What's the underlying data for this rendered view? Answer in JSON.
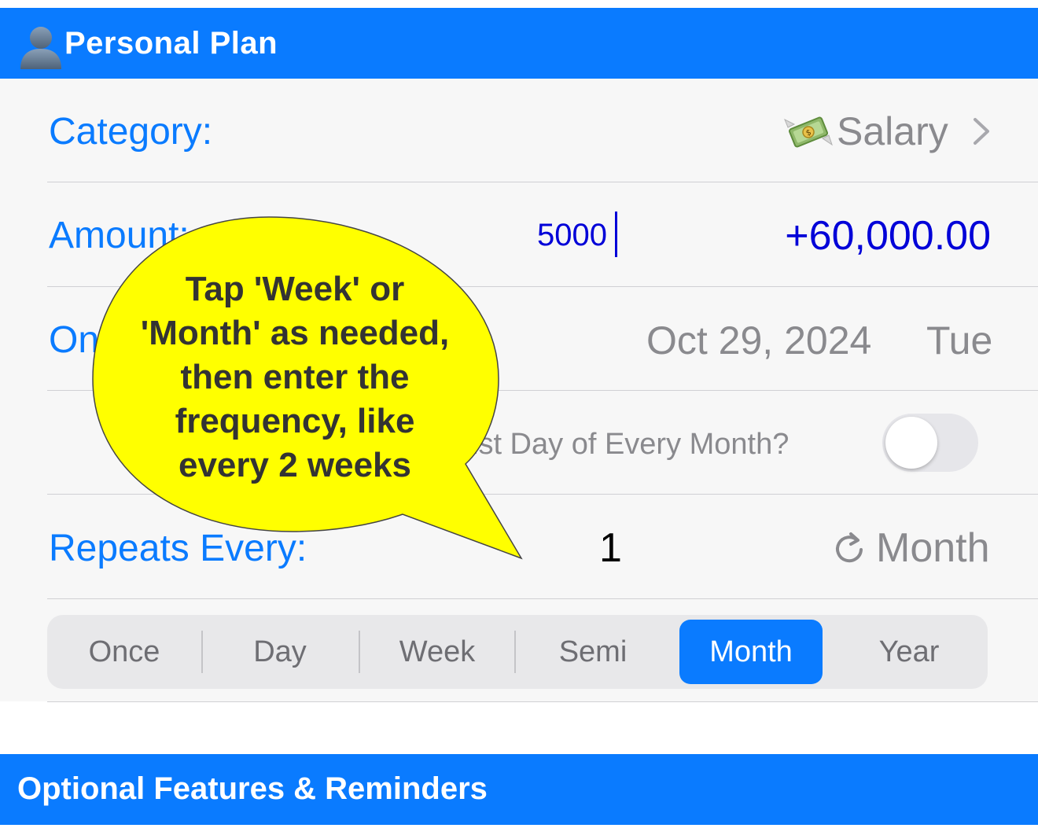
{
  "header": {
    "title": "Personal Plan",
    "icon": "person-icon",
    "color": "#0a7bff"
  },
  "form": {
    "category": {
      "label": "Category:",
      "value": "Salary",
      "icon": "money-with-wings-icon"
    },
    "amount": {
      "label": "Amount:",
      "input_value": "5000",
      "total": "+60,000.00",
      "total_color": "#0000d8"
    },
    "on": {
      "label": "On",
      "date": "Oct 29, 2024",
      "weekday": "Tue"
    },
    "last_day": {
      "label_visible": "ist Day of Every Month?",
      "toggle_on": false
    },
    "repeats": {
      "label": "Repeats Every:",
      "count": "1",
      "unit": "Month",
      "icon": "repeat-icon"
    },
    "frequency": {
      "options": [
        "Once",
        "Day",
        "Week",
        "Semi",
        "Month",
        "Year"
      ],
      "selected": "Month"
    }
  },
  "callout": {
    "lines": [
      "Tap 'Week' or",
      "'Month' as needed,",
      "then enter the",
      "frequency, like",
      "every 2 weeks"
    ],
    "fill_color": "#ffff00"
  },
  "footer": {
    "title": "Optional Features & Reminders"
  }
}
